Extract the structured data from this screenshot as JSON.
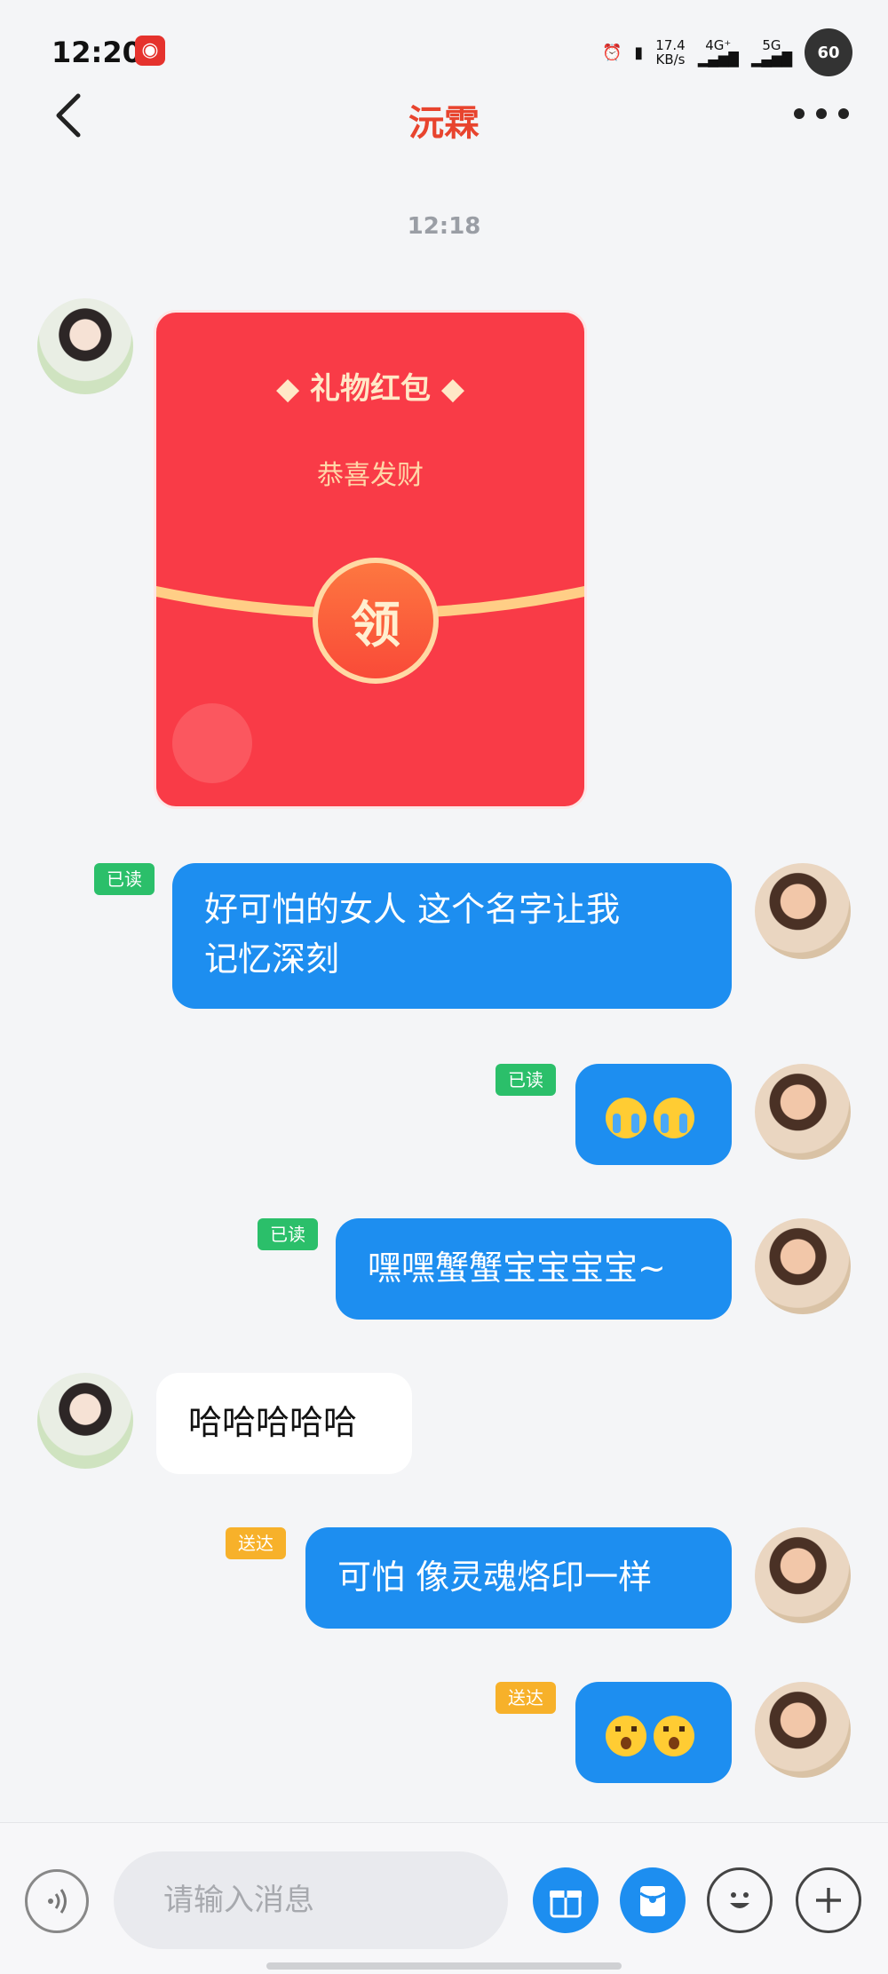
{
  "status_bar": {
    "time": "12:20",
    "network_speed_value": "17.4",
    "network_speed_unit": "KB/s",
    "signal_1": "4G⁺",
    "signal_2": "5G",
    "battery": "60"
  },
  "header": {
    "title": "沅霖"
  },
  "chat": {
    "timestamp": "12:18",
    "red_packet": {
      "title": "礼物红包",
      "subtitle": "恭喜发财",
      "claim_label": "领"
    },
    "messages": [
      {
        "from": "me",
        "status": "已读",
        "text_line1": "好可怕的女人 这个名字让我",
        "text_line2": "记忆深刻"
      },
      {
        "from": "me",
        "status": "已读",
        "text": "😭😭"
      },
      {
        "from": "me",
        "status": "已读",
        "text": "嘿嘿蟹蟹宝宝宝宝~"
      },
      {
        "from": "other",
        "text": "哈哈哈哈哈"
      },
      {
        "from": "me",
        "status": "送达",
        "text": "可怕 像灵魂烙印一样"
      },
      {
        "from": "me",
        "status": "送达",
        "text": "😮😮"
      }
    ]
  },
  "input_bar": {
    "placeholder": "请输入消息"
  },
  "colors": {
    "accent": "#1d8ef0",
    "title": "#e8442e",
    "read_badge": "#2bbf6a",
    "sent_badge": "#f7b12a",
    "red_packet": "#f93b47"
  }
}
